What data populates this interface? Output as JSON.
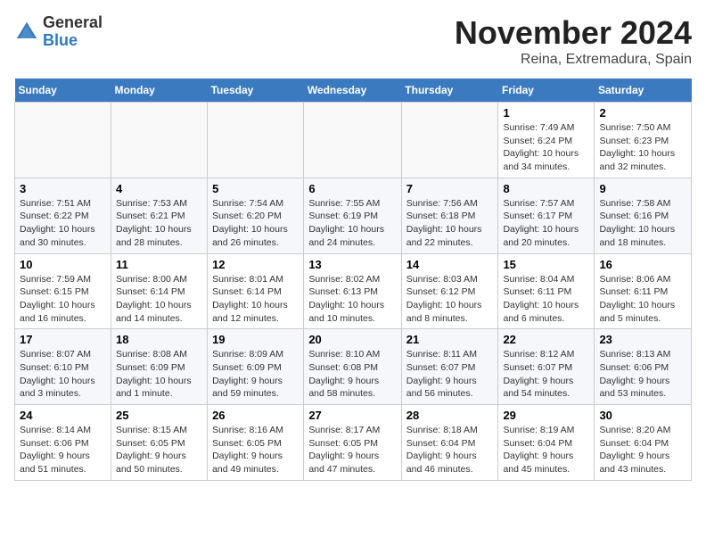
{
  "header": {
    "logo_general": "General",
    "logo_blue": "Blue",
    "month": "November 2024",
    "location": "Reina, Extremadura, Spain"
  },
  "weekdays": [
    "Sunday",
    "Monday",
    "Tuesday",
    "Wednesday",
    "Thursday",
    "Friday",
    "Saturday"
  ],
  "weeks": [
    [
      {
        "day": "",
        "info": ""
      },
      {
        "day": "",
        "info": ""
      },
      {
        "day": "",
        "info": ""
      },
      {
        "day": "",
        "info": ""
      },
      {
        "day": "",
        "info": ""
      },
      {
        "day": "1",
        "info": "Sunrise: 7:49 AM\nSunset: 6:24 PM\nDaylight: 10 hours and 34 minutes."
      },
      {
        "day": "2",
        "info": "Sunrise: 7:50 AM\nSunset: 6:23 PM\nDaylight: 10 hours and 32 minutes."
      }
    ],
    [
      {
        "day": "3",
        "info": "Sunrise: 7:51 AM\nSunset: 6:22 PM\nDaylight: 10 hours and 30 minutes."
      },
      {
        "day": "4",
        "info": "Sunrise: 7:53 AM\nSunset: 6:21 PM\nDaylight: 10 hours and 28 minutes."
      },
      {
        "day": "5",
        "info": "Sunrise: 7:54 AM\nSunset: 6:20 PM\nDaylight: 10 hours and 26 minutes."
      },
      {
        "day": "6",
        "info": "Sunrise: 7:55 AM\nSunset: 6:19 PM\nDaylight: 10 hours and 24 minutes."
      },
      {
        "day": "7",
        "info": "Sunrise: 7:56 AM\nSunset: 6:18 PM\nDaylight: 10 hours and 22 minutes."
      },
      {
        "day": "8",
        "info": "Sunrise: 7:57 AM\nSunset: 6:17 PM\nDaylight: 10 hours and 20 minutes."
      },
      {
        "day": "9",
        "info": "Sunrise: 7:58 AM\nSunset: 6:16 PM\nDaylight: 10 hours and 18 minutes."
      }
    ],
    [
      {
        "day": "10",
        "info": "Sunrise: 7:59 AM\nSunset: 6:15 PM\nDaylight: 10 hours and 16 minutes."
      },
      {
        "day": "11",
        "info": "Sunrise: 8:00 AM\nSunset: 6:14 PM\nDaylight: 10 hours and 14 minutes."
      },
      {
        "day": "12",
        "info": "Sunrise: 8:01 AM\nSunset: 6:14 PM\nDaylight: 10 hours and 12 minutes."
      },
      {
        "day": "13",
        "info": "Sunrise: 8:02 AM\nSunset: 6:13 PM\nDaylight: 10 hours and 10 minutes."
      },
      {
        "day": "14",
        "info": "Sunrise: 8:03 AM\nSunset: 6:12 PM\nDaylight: 10 hours and 8 minutes."
      },
      {
        "day": "15",
        "info": "Sunrise: 8:04 AM\nSunset: 6:11 PM\nDaylight: 10 hours and 6 minutes."
      },
      {
        "day": "16",
        "info": "Sunrise: 8:06 AM\nSunset: 6:11 PM\nDaylight: 10 hours and 5 minutes."
      }
    ],
    [
      {
        "day": "17",
        "info": "Sunrise: 8:07 AM\nSunset: 6:10 PM\nDaylight: 10 hours and 3 minutes."
      },
      {
        "day": "18",
        "info": "Sunrise: 8:08 AM\nSunset: 6:09 PM\nDaylight: 10 hours and 1 minute."
      },
      {
        "day": "19",
        "info": "Sunrise: 8:09 AM\nSunset: 6:09 PM\nDaylight: 9 hours and 59 minutes."
      },
      {
        "day": "20",
        "info": "Sunrise: 8:10 AM\nSunset: 6:08 PM\nDaylight: 9 hours and 58 minutes."
      },
      {
        "day": "21",
        "info": "Sunrise: 8:11 AM\nSunset: 6:07 PM\nDaylight: 9 hours and 56 minutes."
      },
      {
        "day": "22",
        "info": "Sunrise: 8:12 AM\nSunset: 6:07 PM\nDaylight: 9 hours and 54 minutes."
      },
      {
        "day": "23",
        "info": "Sunrise: 8:13 AM\nSunset: 6:06 PM\nDaylight: 9 hours and 53 minutes."
      }
    ],
    [
      {
        "day": "24",
        "info": "Sunrise: 8:14 AM\nSunset: 6:06 PM\nDaylight: 9 hours and 51 minutes."
      },
      {
        "day": "25",
        "info": "Sunrise: 8:15 AM\nSunset: 6:05 PM\nDaylight: 9 hours and 50 minutes."
      },
      {
        "day": "26",
        "info": "Sunrise: 8:16 AM\nSunset: 6:05 PM\nDaylight: 9 hours and 49 minutes."
      },
      {
        "day": "27",
        "info": "Sunrise: 8:17 AM\nSunset: 6:05 PM\nDaylight: 9 hours and 47 minutes."
      },
      {
        "day": "28",
        "info": "Sunrise: 8:18 AM\nSunset: 6:04 PM\nDaylight: 9 hours and 46 minutes."
      },
      {
        "day": "29",
        "info": "Sunrise: 8:19 AM\nSunset: 6:04 PM\nDaylight: 9 hours and 45 minutes."
      },
      {
        "day": "30",
        "info": "Sunrise: 8:20 AM\nSunset: 6:04 PM\nDaylight: 9 hours and 43 minutes."
      }
    ]
  ]
}
